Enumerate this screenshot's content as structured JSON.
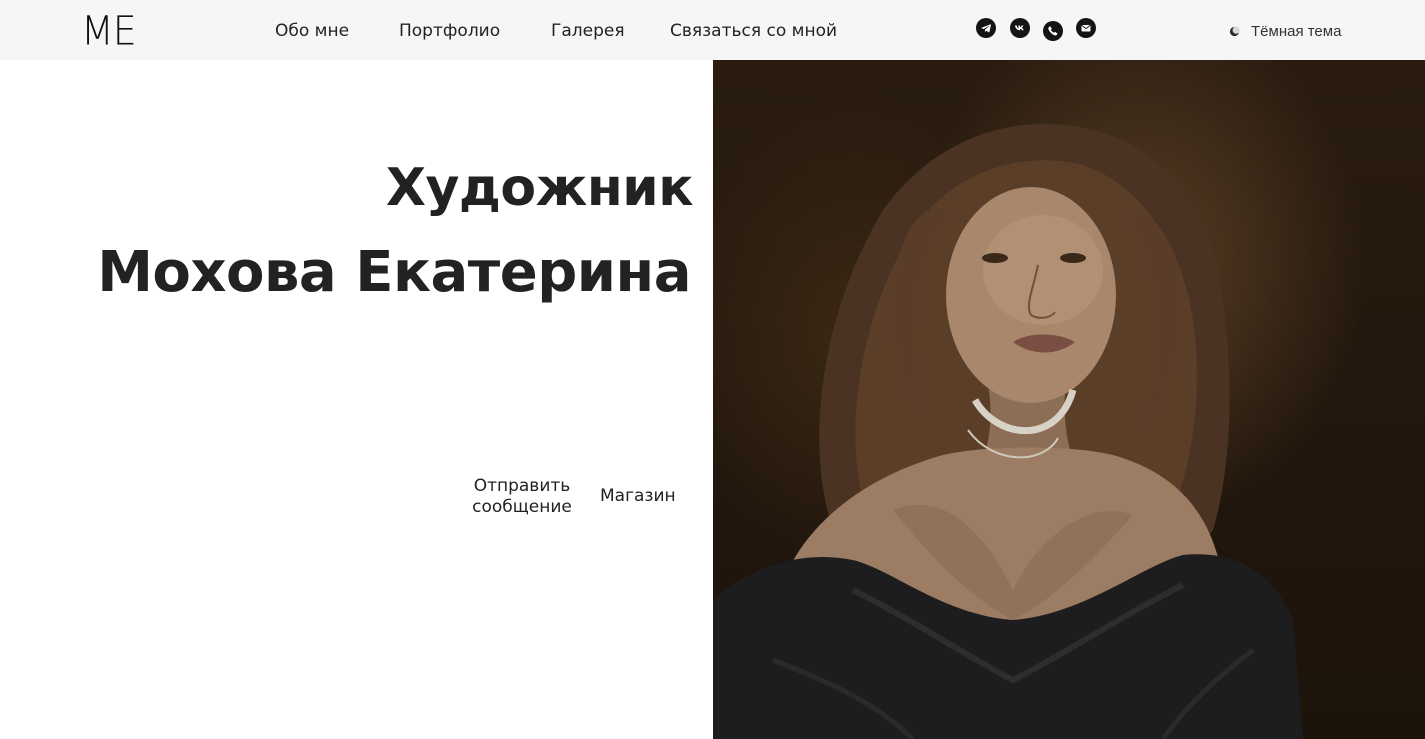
{
  "header": {
    "logo": "ME",
    "nav": [
      "Обо мне",
      "Портфолио",
      "Галерея",
      "Связаться со мной"
    ],
    "socials": [
      "telegram-icon",
      "vk-icon",
      "phone-icon",
      "email-icon"
    ],
    "theme_label": "Тёмная тема"
  },
  "hero": {
    "title_line1": "Художник",
    "title_line2": "Мохова Екатерина",
    "send_message": "Отправить сообщение",
    "shop": "Магазин"
  },
  "portrait": {
    "subject": "portrait-photo"
  },
  "colors": {
    "header_bg": "#f5f6f8",
    "text": "#222222",
    "icon_bg": "#141414"
  }
}
